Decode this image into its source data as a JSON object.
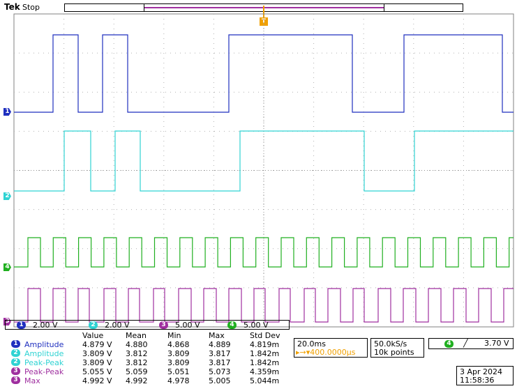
{
  "header": {
    "brand": "Tek",
    "status": "Stop",
    "trigger_marker_label": "T"
  },
  "colors": {
    "ch1": "#1f2fbf",
    "ch2": "#2fd3d3",
    "ch3": "#9f2f9f",
    "ch4": "#1faf1f",
    "trigger": "#f0a000",
    "grid": "#b0b0b0"
  },
  "channel_markers": [
    {
      "label": "1",
      "color": "#1f2fbf"
    },
    {
      "label": "2",
      "color": "#2fd3d3"
    },
    {
      "label": "4",
      "color": "#1faf1f"
    },
    {
      "label": "3",
      "color": "#9f2f9f"
    }
  ],
  "scales": [
    {
      "channel": "1",
      "value": "2.00 V",
      "color": "#1f2fbf"
    },
    {
      "channel": "2",
      "value": "2.00 V",
      "color": "#2fd3d3"
    },
    {
      "channel": "3",
      "value": "5.00 V",
      "color": "#9f2f9f"
    },
    {
      "channel": "4",
      "value": "5.00 V",
      "color": "#1faf1f"
    }
  ],
  "measurements": {
    "headers": [
      "Value",
      "Mean",
      "Min",
      "Max",
      "Std Dev"
    ],
    "rows": [
      {
        "channel": "1",
        "color": "#1f2fbf",
        "name": "Amplitude",
        "value": "4.879 V",
        "mean": "4.880",
        "min": "4.868",
        "max": "4.889",
        "std": "4.819m"
      },
      {
        "channel": "2",
        "color": "#2fd3d3",
        "name": "Amplitude",
        "value": "3.809 V",
        "mean": "3.812",
        "min": "3.809",
        "max": "3.817",
        "std": "1.842m"
      },
      {
        "channel": "2",
        "color": "#2fd3d3",
        "name": "Peak-Peak",
        "value": "3.809 V",
        "mean": "3.812",
        "min": "3.809",
        "max": "3.817",
        "std": "1.842m"
      },
      {
        "channel": "3",
        "color": "#9f2f9f",
        "name": "Peak-Peak",
        "value": "5.055 V",
        "mean": "5.059",
        "min": "5.051",
        "max": "5.073",
        "std": "4.359m"
      },
      {
        "channel": "3",
        "color": "#9f2f9f",
        "name": "Max",
        "value": "4.992 V",
        "mean": "4.992",
        "min": "4.978",
        "max": "5.005",
        "std": "5.044m"
      }
    ]
  },
  "timebase": {
    "scale": "20.0ms",
    "trigger_position": "▸→▾400.0000µs"
  },
  "acquisition": {
    "sample_rate": "50.0kS/s",
    "record_length": "10k points"
  },
  "trigger": {
    "source": "4",
    "slope": "╱",
    "level": "3.70 V"
  },
  "clock": {
    "date": "3 Apr  2024",
    "time": "11:58:36"
  }
}
